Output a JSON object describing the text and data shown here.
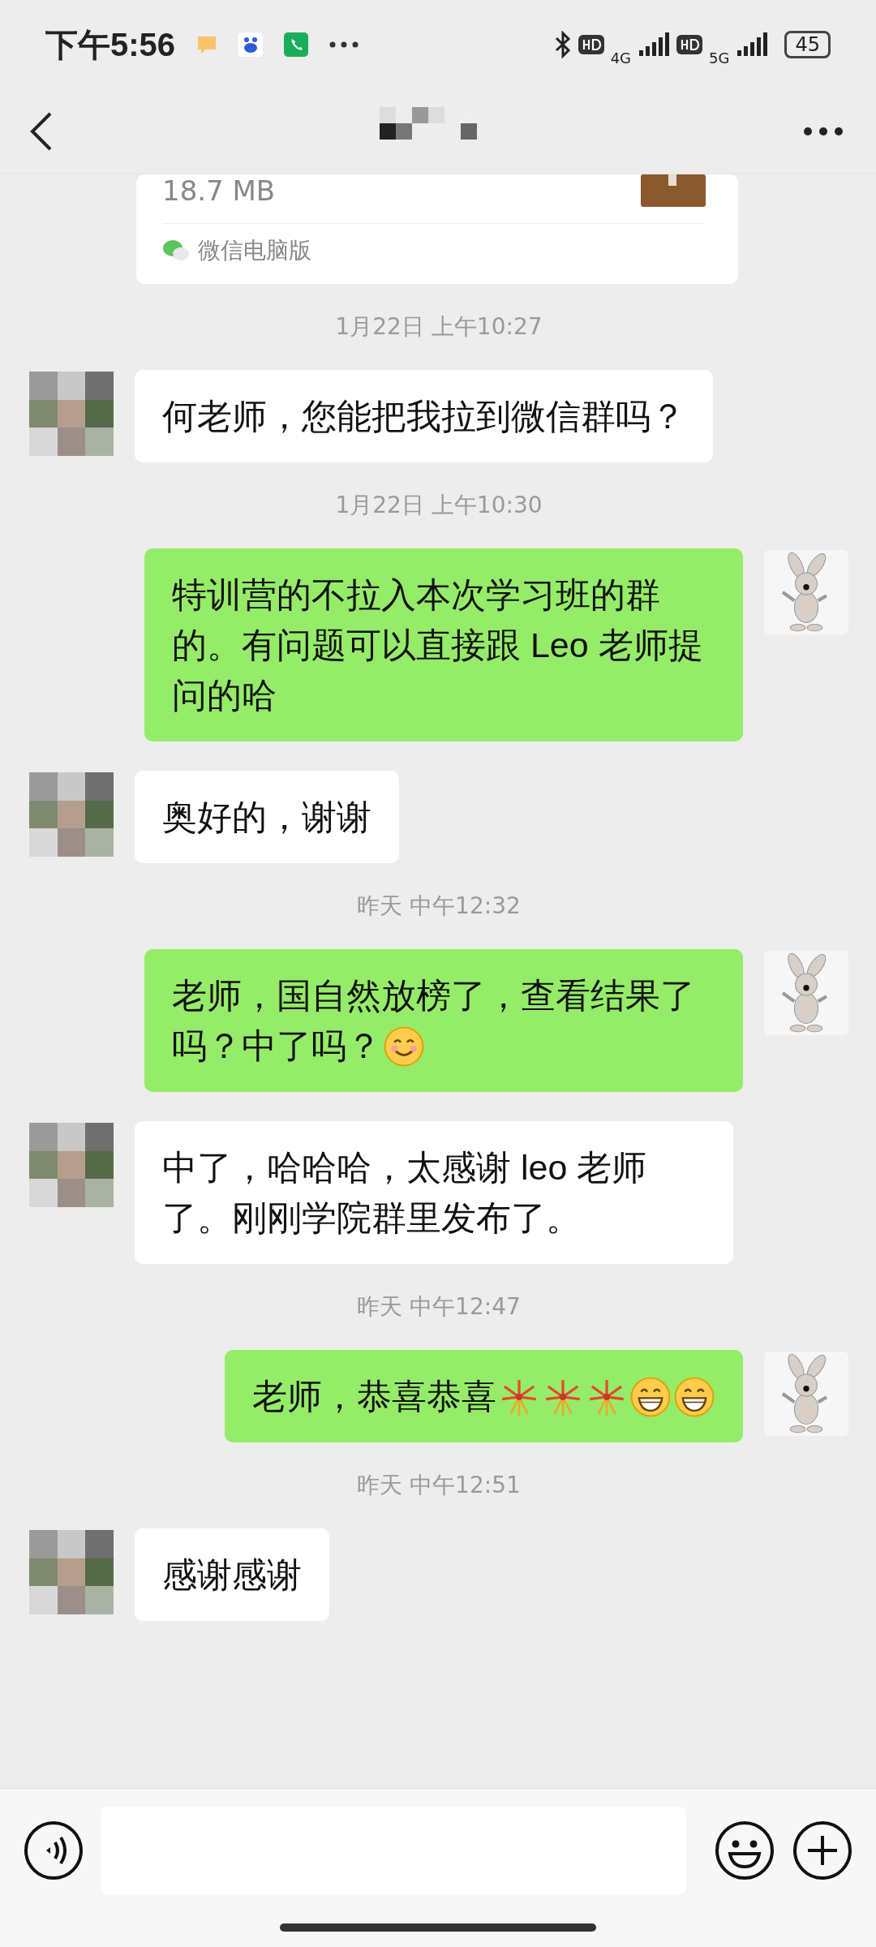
{
  "status_bar": {
    "time": "下午5:56",
    "network_1": "4G",
    "network_2": "5G",
    "battery": "45"
  },
  "file_card": {
    "size": "18.7 MB",
    "source": "微信电脑版"
  },
  "messages": [
    {
      "kind": "time",
      "text": "1月22日 上午10:27"
    },
    {
      "kind": "in",
      "text": "何老师，您能把我拉到微信群吗？"
    },
    {
      "kind": "time",
      "text": "1月22日 上午10:30"
    },
    {
      "kind": "out",
      "text": "特训营的不拉入本次学习班的群的。有问题可以直接跟 Leo 老师提问的哈"
    },
    {
      "kind": "in",
      "text": "奥好的，谢谢"
    },
    {
      "kind": "time",
      "text": "昨天 中午12:32"
    },
    {
      "kind": "out",
      "text": "老师，国自然放榜了，查看结果了吗？中了吗？",
      "emoji": [
        {
          "kind": "smile"
        }
      ]
    },
    {
      "kind": "in",
      "text": "中了，哈哈哈，太感谢 leo 老师了。刚刚学院群里发布了。"
    },
    {
      "kind": "time",
      "text": "昨天 中午12:47"
    },
    {
      "kind": "out",
      "text": "老师，恭喜恭喜",
      "emoji": [
        {
          "kind": "fireworks"
        },
        {
          "kind": "fireworks"
        },
        {
          "kind": "fireworks"
        },
        {
          "kind": "grin"
        },
        {
          "kind": "grin"
        }
      ]
    },
    {
      "kind": "time",
      "text": "昨天 中午12:51"
    },
    {
      "kind": "in",
      "text": "感谢感谢"
    }
  ]
}
